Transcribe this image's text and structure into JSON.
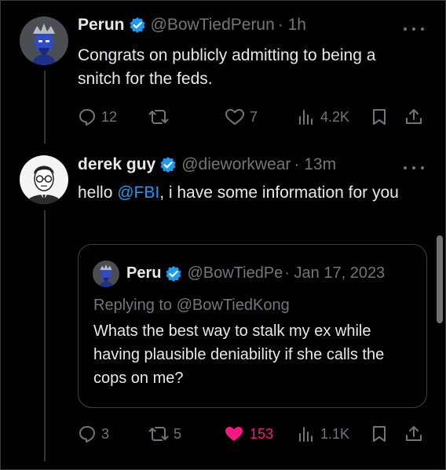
{
  "tweets": [
    {
      "name": "Perun",
      "handle": "@BowTiedPerun",
      "time": "· 1h",
      "text": "Congrats on publicly admitting to being a snitch for the feds.",
      "replies": "12",
      "retweets": "",
      "likes": "7",
      "views": "4.2K"
    },
    {
      "name": "derek guy",
      "handle": "@dieworkwear",
      "time": "· 13m",
      "text_before": "hello ",
      "mention": "@FBI",
      "text_after": ", i have some information for you",
      "replies": "3",
      "retweets": "5",
      "likes": "153",
      "views": "1.1K",
      "quote": {
        "name": "Peru",
        "handle": "@BowTiedPe",
        "time": "· Jan 17, 2023",
        "replying_to": "Replying to @BowTiedKong",
        "text": "Whats the best way to stalk my ex while having plausible deniability if she calls the cops on me?"
      }
    }
  ],
  "icons": {
    "verified": "verified-badge-icon",
    "reply": "reply-icon",
    "retweet": "retweet-icon",
    "like": "heart-icon",
    "views": "views-icon",
    "bookmark": "bookmark-icon",
    "share": "share-icon",
    "more": "more-icon"
  },
  "colors": {
    "background": "#000000",
    "text": "#e7e9ea",
    "muted": "#71767b",
    "accent": "#1d9bf0",
    "like": "#f91880"
  }
}
